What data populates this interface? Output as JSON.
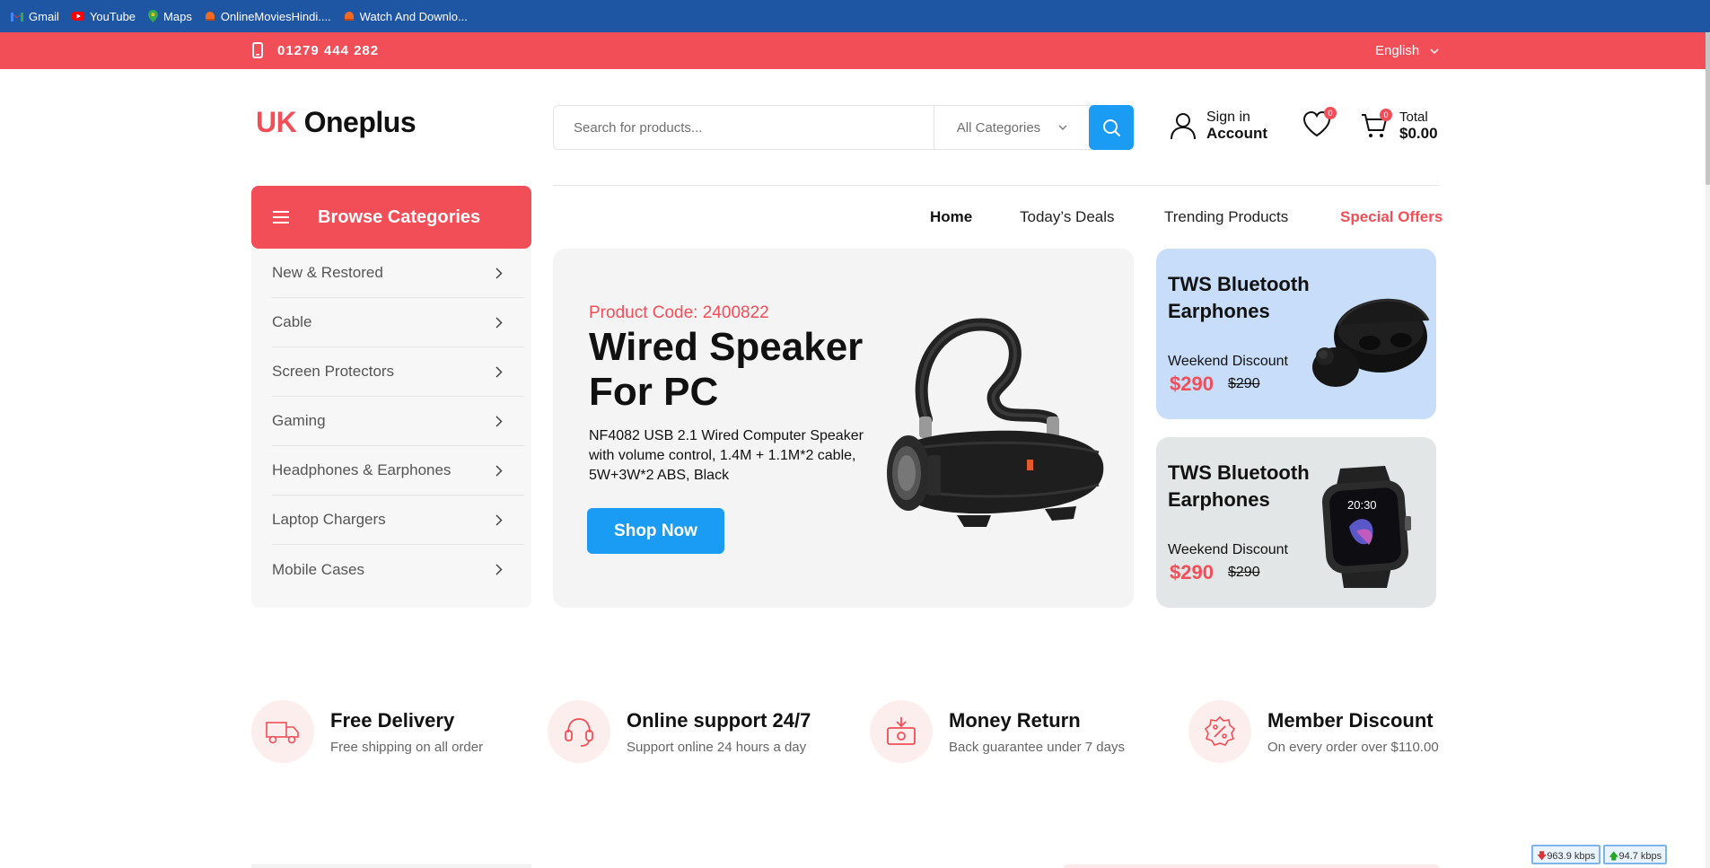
{
  "bookmarks": [
    {
      "label": "Gmail",
      "icon": "gmail-icon",
      "color": "#ea4335"
    },
    {
      "label": "YouTube",
      "icon": "youtube-icon",
      "color": "#ff0000"
    },
    {
      "label": "Maps",
      "icon": "maps-icon",
      "color": "#34a853"
    },
    {
      "label": "OnlineMoviesHindi....",
      "icon": "site-icon",
      "color": "#f26a22"
    },
    {
      "label": "Watch And Downlo...",
      "icon": "site-icon",
      "color": "#f26a22"
    }
  ],
  "topbar": {
    "phone": "01279 444 282",
    "language": "English",
    "bg_color": "#f24e57"
  },
  "header": {
    "logo_part1": "UK",
    "logo_part2": "Oneplus",
    "search_placeholder": "Search for products...",
    "category_select": "All Categories",
    "account_line1": "Sign in",
    "account_line2": "Account",
    "wishlist_count": "0",
    "cart_count": "0",
    "cart_label": "Total",
    "cart_total": "$0.00"
  },
  "categories": {
    "title": "Browse Categories",
    "items": [
      "New & Restored",
      "Cable",
      "Screen Protectors",
      "Gaming",
      "Headphones & Earphones",
      "Laptop Chargers",
      "Mobile Cases"
    ]
  },
  "nav": {
    "items": [
      "Home",
      "Today’s Deals",
      "Trending Products",
      "Special Offers"
    ],
    "active": "Home",
    "highlight": "Special Offers"
  },
  "hero": {
    "code": "Product Code: 2400822",
    "title": "Wired Speaker For PC",
    "description": "NF4082 USB 2.1 Wired Computer Speaker with volume control, 1.4M + 1.1M*2 cable, 5W+3W*2 ABS, Black",
    "button": "Shop Now"
  },
  "promos": [
    {
      "title": "TWS Bluetooth Earphones",
      "discount": "Weekend Discount",
      "price": "$290",
      "old_price": "$290",
      "bg": "#c7ddf9",
      "image": "earbuds"
    },
    {
      "title": "TWS Bluetooth Earphones",
      "discount": "Weekend Discount",
      "price": "$290",
      "old_price": "$290",
      "bg": "#e3e6e6",
      "image": "smartwatch",
      "watch_time": "20:30"
    }
  ],
  "features": [
    {
      "title": "Free Delivery",
      "desc": "Free shipping on all order",
      "icon": "truck-icon"
    },
    {
      "title": "Online support 24/7",
      "desc": "Support online 24 hours a day",
      "icon": "headset-icon"
    },
    {
      "title": "Money Return",
      "desc": "Back guarantee under 7 days",
      "icon": "money-return-icon"
    },
    {
      "title": "Member Discount",
      "desc": "On every order over $110.00",
      "icon": "discount-icon"
    }
  ],
  "netmon": {
    "down": "963.9 kbps",
    "up": "94.7 kbps"
  },
  "colors": {
    "accent": "#f24e57",
    "primary_blue": "#1a9bf4",
    "bookmark_bar": "#1f56a3"
  }
}
